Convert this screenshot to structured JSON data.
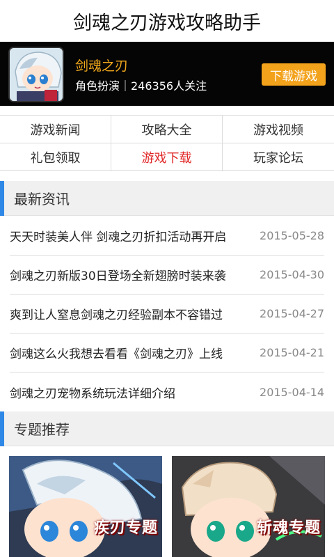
{
  "app": {
    "title": "剑魂之刃游戏攻略助手"
  },
  "game": {
    "name": "剑魂之刃",
    "meta": "角色扮演｜246356人关注",
    "download_label": "下载游戏"
  },
  "nav": {
    "items": [
      {
        "label": "游戏新闻"
      },
      {
        "label": "攻略大全"
      },
      {
        "label": "游戏视频"
      },
      {
        "label": "礼包领取"
      },
      {
        "label": "游戏下载",
        "active": true
      },
      {
        "label": "玩家论坛"
      }
    ]
  },
  "news": {
    "section_title": "最新资讯",
    "items": [
      {
        "title": "天天时装美人伴 剑魂之刃折扣活动再开启",
        "date": "2015-05-28"
      },
      {
        "title": "剑魂之刃新版30日登场全新翅膀时装来袭",
        "date": "2015-04-30"
      },
      {
        "title": "爽到让人窒息剑魂之刃经验副本不容错过",
        "date": "2015-04-27"
      },
      {
        "title": "剑魂这么火我想去看看《剑魂之刃》上线",
        "date": "2015-04-21"
      },
      {
        "title": "剑魂之刃宠物系统玩法详细介绍",
        "date": "2015-04-14"
      }
    ]
  },
  "topics": {
    "section_title": "专题推荐",
    "items": [
      {
        "label": "疾刃专题"
      },
      {
        "label": "斩魂专题"
      }
    ]
  },
  "colors": {
    "accent_orange": "#f3a21b",
    "active_red": "#e02424",
    "section_blue": "#2f88e6"
  }
}
